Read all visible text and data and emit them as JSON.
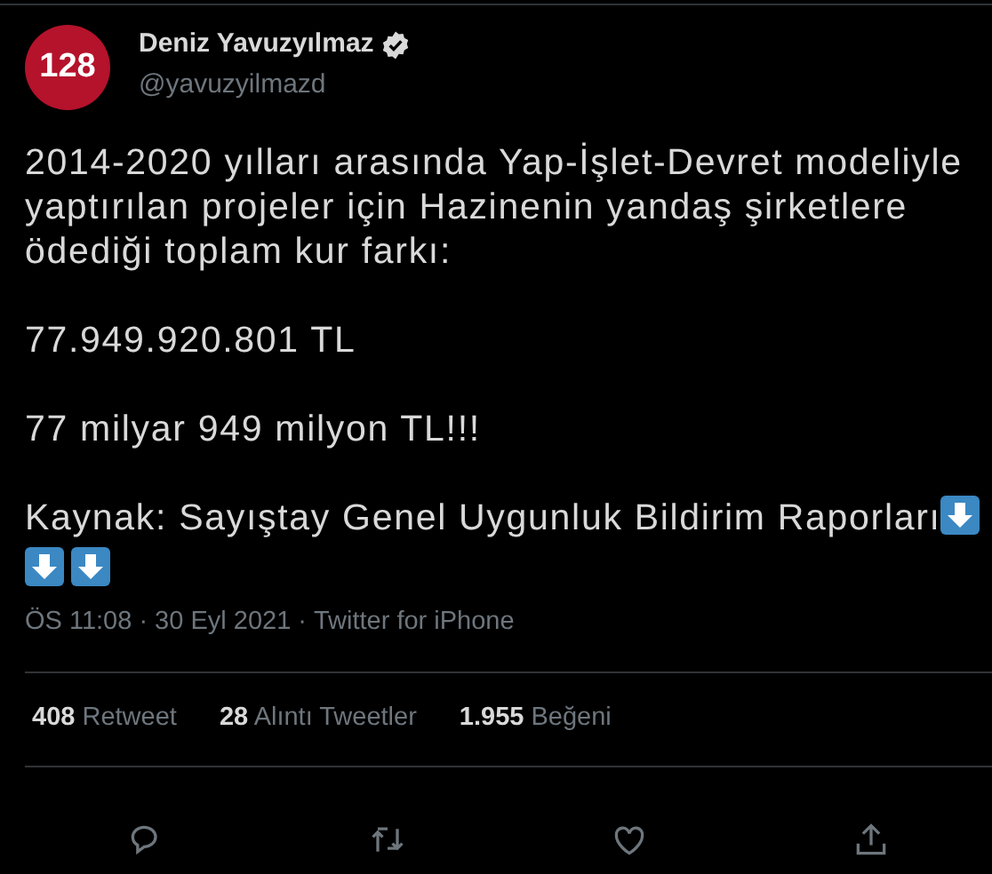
{
  "author": {
    "avatar_text": "128",
    "name": "Deniz Yavuzyılmaz",
    "verified": true,
    "handle": "@yavuzyilmazd"
  },
  "body": [
    [
      "2014-2020 yılları arasında Yap-İşlet-Devret modeliyle",
      "yaptırılan projeler için Hazinenin yandaş şirketlere",
      "ödediği toplam kur farkı:"
    ],
    [
      "77.949.920.801 TL"
    ],
    [
      "77 milyar 949 milyon TL!!!"
    ],
    [
      "Kaynak: Sayıştay Genel Uygunluk Bildirim Raporları"
    ]
  ],
  "meta": [
    "ÖS 11:08",
    "·",
    "30 Eyl 2021",
    "·",
    "Twitter for iPhone"
  ],
  "stats": [
    {
      "count": "408",
      "label": "Retweet"
    },
    {
      "count": "28",
      "label": "Alıntı Tweetler"
    },
    {
      "count": "1.955",
      "label": "Beğeni"
    }
  ]
}
